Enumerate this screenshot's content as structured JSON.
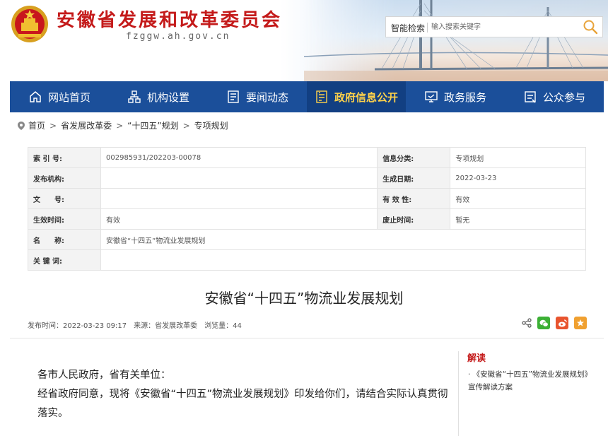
{
  "header": {
    "site_title": "安徽省发展和改革委员会",
    "site_domain": "fzggw.ah.gov.cn",
    "search": {
      "label": "智能检索",
      "placeholder": "输入搜索关键字"
    }
  },
  "nav": {
    "items": [
      {
        "label": "网站首页",
        "icon": "home-icon"
      },
      {
        "label": "机构设置",
        "icon": "org-chart-icon"
      },
      {
        "label": "要闻动态",
        "icon": "news-icon"
      },
      {
        "label": "政府信息公开",
        "icon": "info-disclosure-icon",
        "active": true
      },
      {
        "label": "政务服务",
        "icon": "service-icon"
      },
      {
        "label": "公众参与",
        "icon": "participation-icon"
      }
    ]
  },
  "breadcrumb": [
    "首页",
    "省发展改革委",
    "“十四五”规划",
    "专项规划"
  ],
  "info": {
    "index_label": "索 引 号:",
    "index_value": "002985931/202203-00078",
    "category_label": "信息分类:",
    "category_value": "专项规划",
    "publisher_label": "发布机构:",
    "publisher_value": "",
    "created_label": "生成日期:",
    "created_value": "2022-03-23",
    "docno_label": "文　　号:",
    "docno_value": "",
    "validity_label": "有 效 性:",
    "validity_value": "有效",
    "effective_label": "生效时间:",
    "effective_value": "有效",
    "expire_label": "废止时间:",
    "expire_value": "暂无",
    "name_label": "名　　称:",
    "name_value": "安徽省“十四五”物流业发展规划",
    "keywords_label": "关 键 词:",
    "keywords_value": ""
  },
  "article": {
    "title": "安徽省“十四五”物流业发展规划",
    "publish_time": "发布时间：2022-03-23 09:17",
    "source": "来源：省发展改革委",
    "views": "浏览量：44",
    "para1": "各市人民政府，省有关单位：",
    "para2": "经省政府同意，现将《安徽省“十四五”物流业发展规划》印发给你们，请结合实际认真贯彻落实。"
  },
  "sidebar": {
    "title": "解读",
    "link": "· 《安徽省“十四五”物流业发展规划》宣传解读方案"
  },
  "colors": {
    "brand_red": "#c41a1a",
    "nav_blue": "#1b4f9a",
    "nav_active_text": "#ffd24a"
  }
}
